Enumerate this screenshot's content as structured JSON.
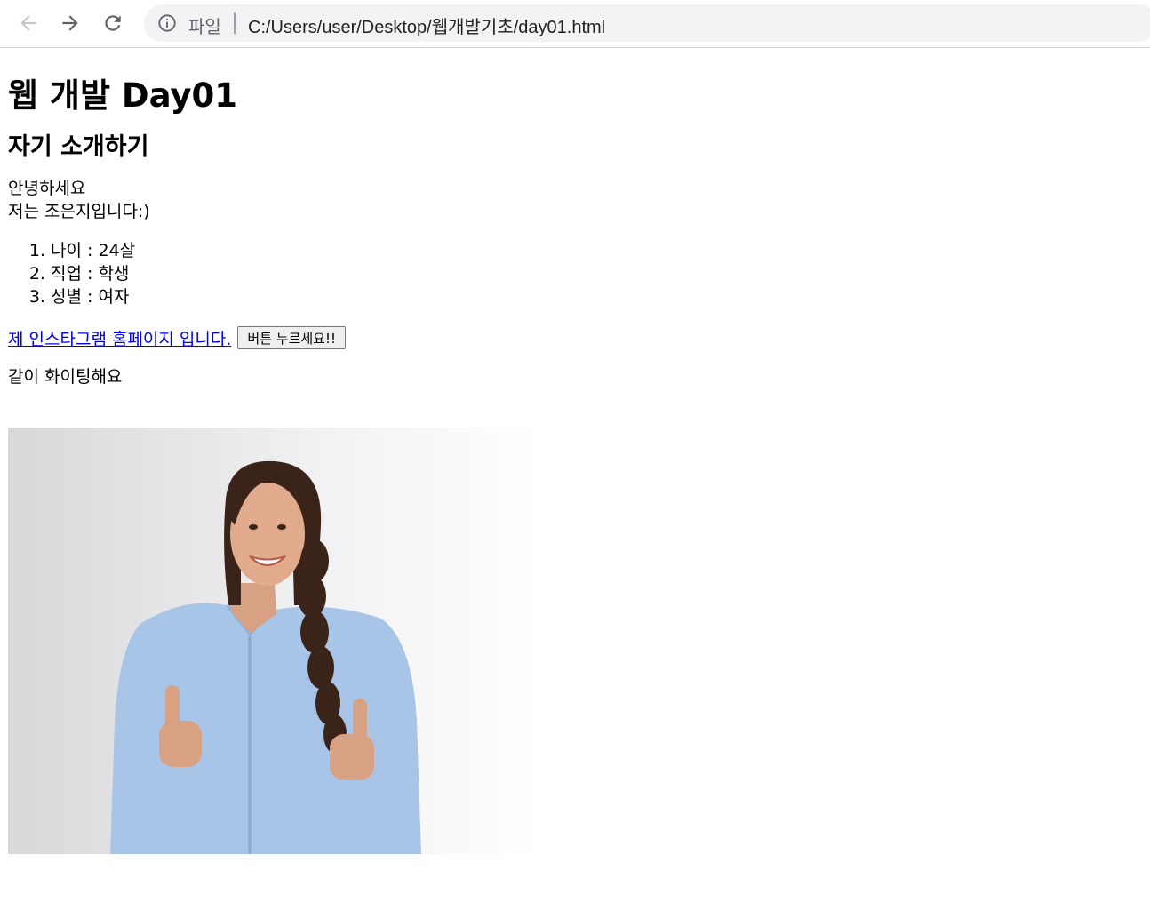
{
  "browser": {
    "scheme_label": "파일",
    "url": "C:/Users/user/Desktop/웹개발기초/day01.html"
  },
  "page": {
    "title": "웹 개발 Day01",
    "subtitle": "자기 소개하기",
    "greeting_line1": "안녕하세요",
    "greeting_line2": "저는 조은지입니다:)",
    "list_items": [
      "나이 : 24살",
      "직업 : 학생",
      "성별 : 여자"
    ],
    "link_text": "제 인스타그램 홈페이지 입니다.",
    "button_label": "버튼 누르세요!!",
    "cheer": "같이 화이팅해요"
  },
  "colors": {
    "link": "#0000ee",
    "omnibox_bg": "#f1f3f4",
    "shirt": "#a8c4e6",
    "hair": "#3a2318"
  }
}
